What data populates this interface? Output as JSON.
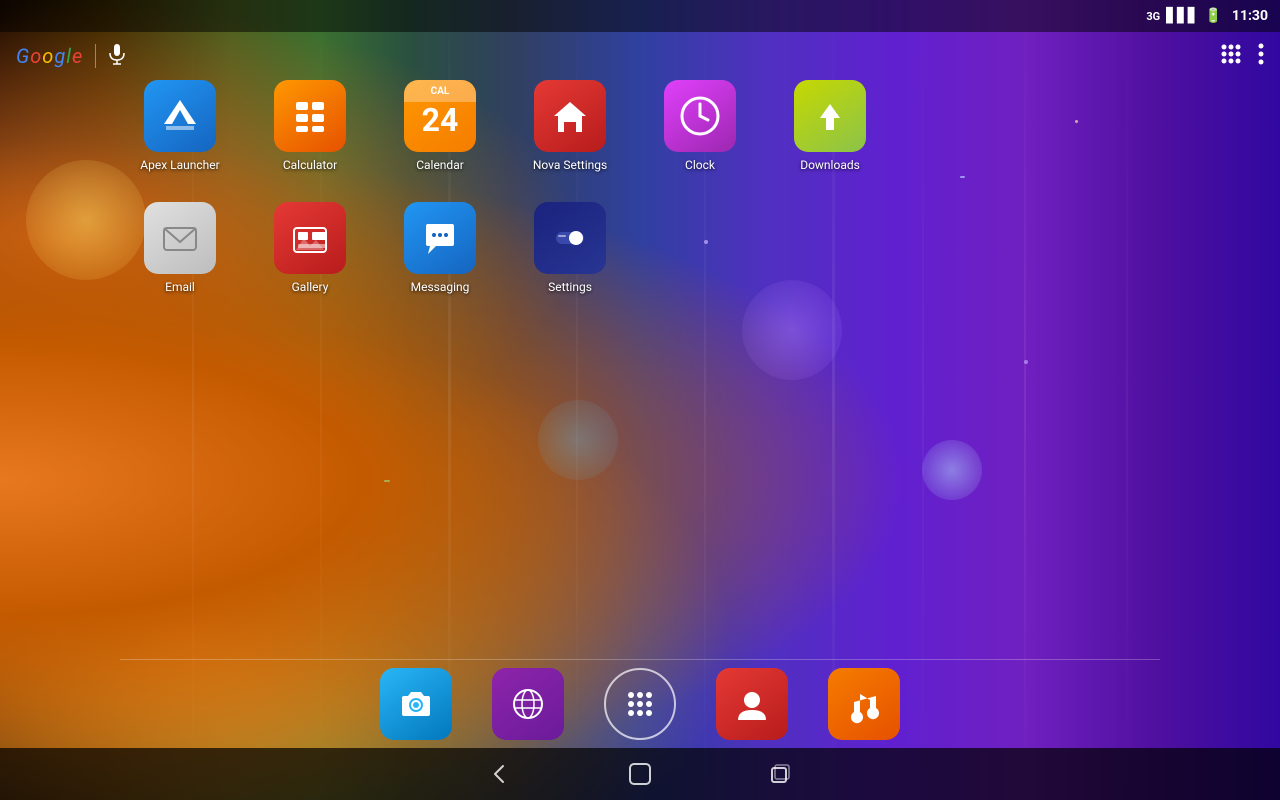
{
  "statusBar": {
    "network": "3G",
    "time": "11:30",
    "batteryIcon": "battery"
  },
  "topBar": {
    "googleLabel": "Google",
    "micLabel": "mic"
  },
  "gridRow1": [
    {
      "id": "apex-launcher",
      "label": "Apex Launcher",
      "iconStyle": "apex"
    },
    {
      "id": "calculator",
      "label": "Calculator",
      "iconStyle": "calculator"
    },
    {
      "id": "calendar",
      "label": "Calendar",
      "iconStyle": "calendar",
      "calNum": "24"
    },
    {
      "id": "nova-settings",
      "label": "Nova Settings",
      "iconStyle": "nova"
    },
    {
      "id": "clock",
      "label": "Clock",
      "iconStyle": "clock"
    },
    {
      "id": "downloads",
      "label": "Downloads",
      "iconStyle": "downloads"
    }
  ],
  "gridRow2": [
    {
      "id": "email",
      "label": "Email",
      "iconStyle": "email"
    },
    {
      "id": "gallery",
      "label": "Gallery",
      "iconStyle": "gallery"
    },
    {
      "id": "messaging",
      "label": "Messaging",
      "iconStyle": "messaging"
    },
    {
      "id": "settings",
      "label": "Settings",
      "iconStyle": "settings"
    }
  ],
  "dock": [
    {
      "id": "camera",
      "iconStyle": "dock-camera"
    },
    {
      "id": "browser",
      "iconStyle": "dock-browser"
    },
    {
      "id": "app-launcher",
      "iconStyle": "dock-launcher"
    },
    {
      "id": "contacts",
      "iconStyle": "dock-contacts"
    },
    {
      "id": "music",
      "iconStyle": "dock-music"
    }
  ],
  "navBar": {
    "backLabel": "back",
    "homeLabel": "home",
    "recentLabel": "recent"
  }
}
